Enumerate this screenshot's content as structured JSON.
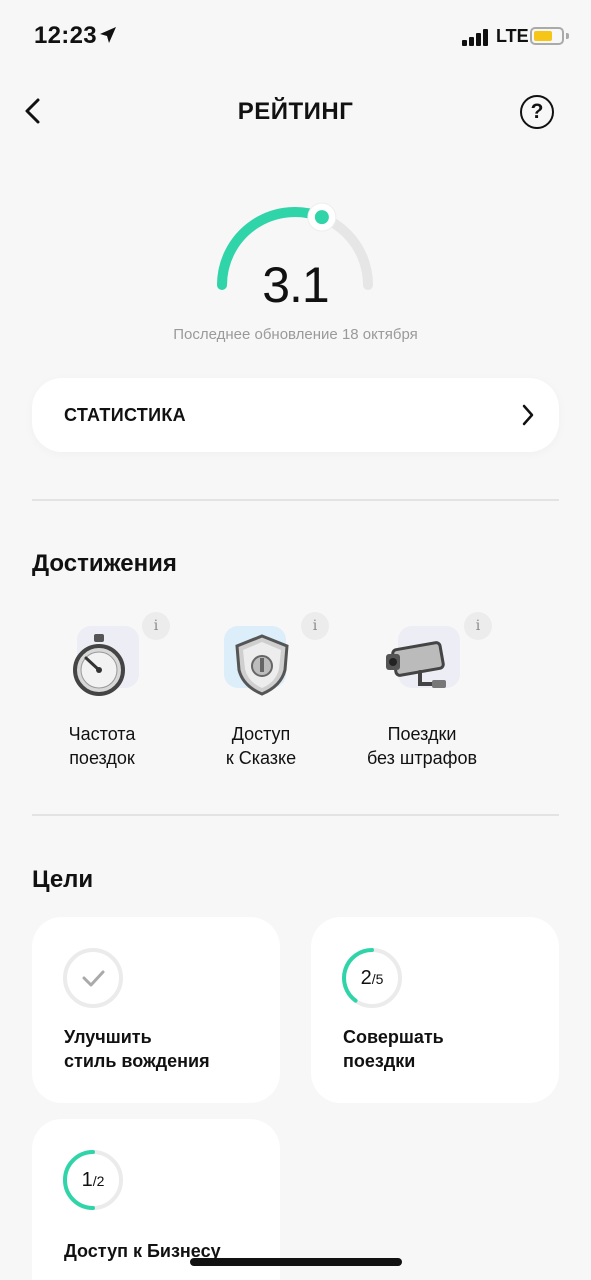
{
  "status_bar": {
    "time": "12:23",
    "network": "LTE",
    "battery_color": "#f5c518"
  },
  "header": {
    "title": "РЕЙТИНГ",
    "back_icon": "chevron-left-icon",
    "help_icon": "question-circle-icon"
  },
  "rating": {
    "value": "3.1",
    "max": 5,
    "update_text": "Последнее обновление 18 октября",
    "accent": "#2fd4a9"
  },
  "statistics": {
    "label": "СТАТИСТИКА"
  },
  "achievements": {
    "title": "Достижения",
    "items": [
      {
        "line1": "Частота",
        "line2": "поездок",
        "icon": "stopwatch-icon",
        "bg": "#ecedf5"
      },
      {
        "line1": "Доступ",
        "line2": "к Сказке",
        "icon": "shield-icon",
        "bg": "#dbeef9"
      },
      {
        "line1": "Поездки",
        "line2": "без штрафов",
        "icon": "camera-icon",
        "bg": "#ecedf5"
      }
    ]
  },
  "goals": {
    "title": "Цели",
    "items": [
      {
        "done": true,
        "count": "",
        "total": "",
        "line1": "Улучшить",
        "line2": "стиль вождения"
      },
      {
        "done": false,
        "count": "2",
        "total": "/5",
        "progress": 0.4,
        "line1": "Совершать",
        "line2": "поездки"
      },
      {
        "done": false,
        "count": "1",
        "total": "/2",
        "progress": 0.5,
        "line1": "Доступ к Бизнесу",
        "line2": ""
      }
    ]
  }
}
